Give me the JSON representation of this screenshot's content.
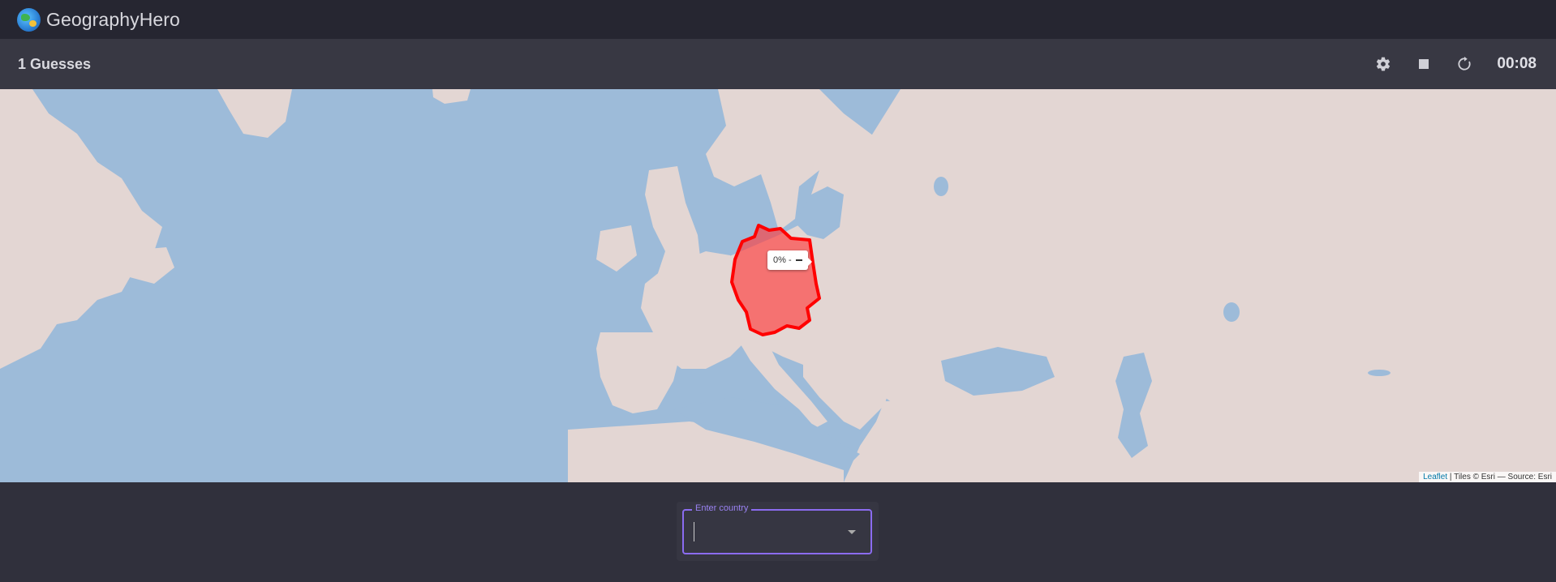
{
  "app": {
    "title": "GeographyHero",
    "logo_icon": "globe-icon"
  },
  "gamebar": {
    "guesses_label": "1 Guesses",
    "timer": "00:08",
    "icons": [
      "gear-icon",
      "stop-icon",
      "restart-icon"
    ]
  },
  "map": {
    "highlighted_country_color": "#ff0000",
    "tooltip": "0% -",
    "attribution_link": "Leaflet",
    "attribution_text": " | Tiles © Esri — Source: Esri"
  },
  "input": {
    "label": "Enter country",
    "value": "",
    "placeholder": ""
  },
  "colors": {
    "topbar": "#262631",
    "gamebar": "#383843",
    "sea": "#9dbbd9",
    "land": "#e3d6d3",
    "accent": "#8b6cf0"
  }
}
